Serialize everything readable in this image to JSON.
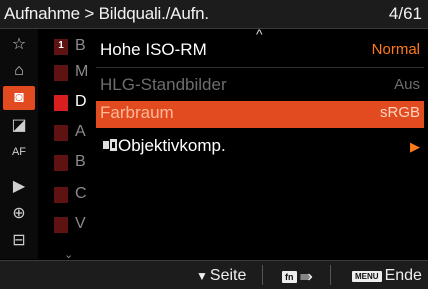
{
  "header": {
    "breadcrumb": "Aufnahme > Bildquali./Aufn.",
    "page_indicator": "4/61"
  },
  "sidebar": {
    "icons": [
      {
        "name": "star-icon",
        "glyph": "☆"
      },
      {
        "name": "home-icon",
        "glyph": "⌂"
      },
      {
        "name": "camera-icon",
        "glyph": "◙"
      },
      {
        "name": "exposure-icon",
        "glyph": "◪"
      },
      {
        "name": "af-icon",
        "glyph": "AF"
      },
      {
        "name": "playback-icon",
        "glyph": "▶"
      },
      {
        "name": "network-icon",
        "glyph": "⊕"
      },
      {
        "name": "toolbox-icon",
        "glyph": "⊟"
      }
    ]
  },
  "subtabs": {
    "box_label": "1",
    "items": [
      {
        "letter": "B"
      },
      {
        "letter": "M"
      },
      {
        "letter": "D"
      },
      {
        "letter": "A"
      },
      {
        "letter": "B"
      },
      {
        "letter": "C"
      },
      {
        "letter": "V"
      }
    ]
  },
  "menu": {
    "scroll_up_glyph": "^",
    "scroll_down_glyph": "⌄",
    "rows": [
      {
        "label": "Hohe ISO-RM",
        "value": "Normal"
      },
      {
        "label": "HLG-Standbilder",
        "value": "Aus"
      },
      {
        "label": "Farbraum",
        "value": "sRGB"
      },
      {
        "label": "Objektivkomp.",
        "value": "▶",
        "icon": "lens-icon"
      }
    ]
  },
  "footer": {
    "page_label": "Seite",
    "page_glyph": "▼",
    "fn_chip": "fn",
    "fn_glyph": "⇛",
    "menu_chip": "MENU",
    "end_label": "Ende"
  },
  "colors": {
    "accent": "#e24a1f",
    "value_orange": "#ff7a1a",
    "tab_red": "#d81e1e"
  }
}
